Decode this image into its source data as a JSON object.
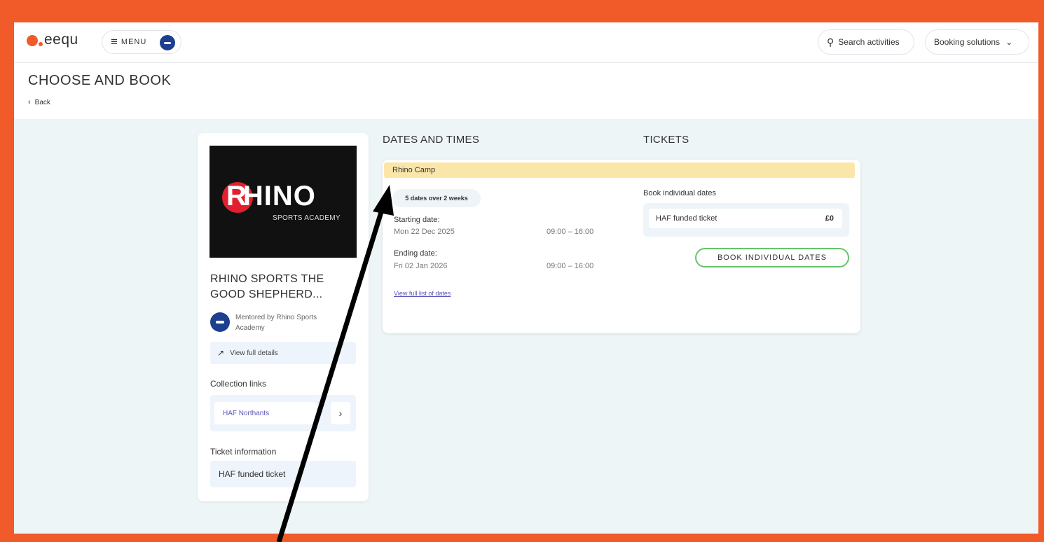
{
  "header": {
    "logo_text": "eequ",
    "menu_label": "MENU",
    "search_label": "Search activities",
    "booking_label": "Booking solutions"
  },
  "title_bar": {
    "title": "CHOOSE AND BOOK",
    "back_label": "Back"
  },
  "activity": {
    "logo_text": "HINO",
    "logo_sub": "SPORTS ACADEMY",
    "title": "RHINO SPORTS THE GOOD SHEPHERD...",
    "mentor": "Mentored by Rhino Sports Academy",
    "view_full_details": "View full details",
    "collection_links_label": "Collection links",
    "collection_link": "HAF Northants",
    "ticket_info_label": "Ticket information",
    "ticket_info_value": "HAF funded ticket"
  },
  "dates": {
    "heading": "DATES AND TIMES",
    "camp_name": "Rhino Camp",
    "summary": "5 dates over 2 weeks",
    "start_label": "Starting date:",
    "start_date": "Mon 22 Dec 2025",
    "start_time": "09:00 – 16:00",
    "end_label": "Ending date:",
    "end_date": "Fri 02 Jan 2026",
    "end_time": "09:00 – 16:00",
    "view_list": "View full list of dates"
  },
  "tickets": {
    "heading": "TICKETS",
    "book_individual_label": "Book individual dates",
    "ticket_name": "HAF funded ticket",
    "ticket_price": "£0",
    "book_button": "BOOK INDIVIDUAL DATES"
  },
  "colors": {
    "border_orange": "#f15a29",
    "camp_bar": "#fbe6aa",
    "book_btn_border": "#67c56a",
    "link_purple": "#5a55b7"
  }
}
